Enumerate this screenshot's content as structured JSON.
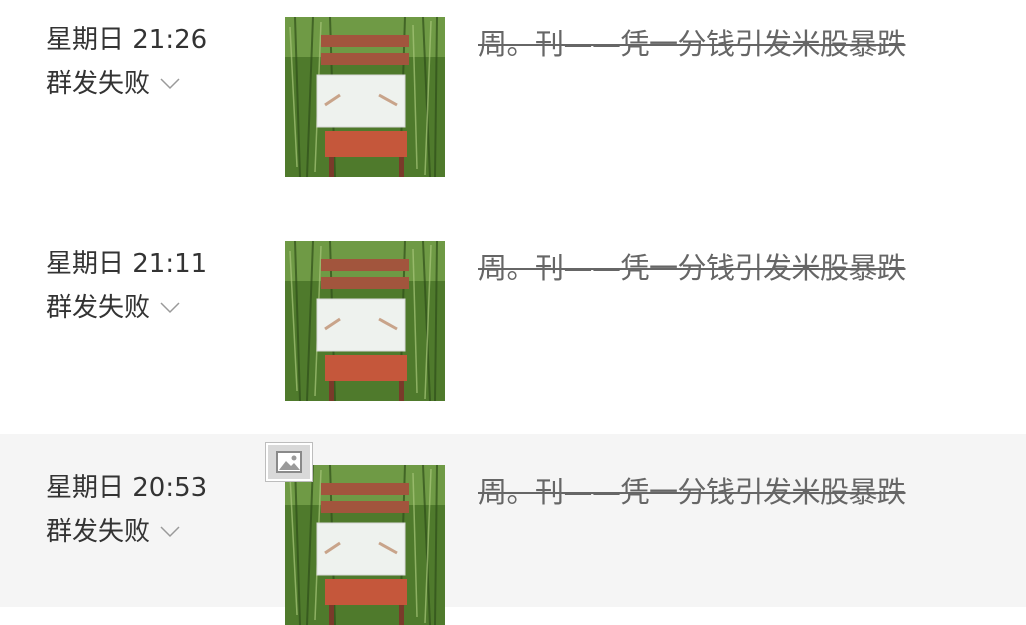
{
  "messages": [
    {
      "time": "星期日 21:26",
      "status": "群发失败",
      "title": "周。刊——凭一分钱引发米股暴跌"
    },
    {
      "time": "星期日 21:11",
      "status": "群发失败",
      "title": "周。刊——凭一分钱引发米股暴跌"
    },
    {
      "time": "星期日 20:53",
      "status": "群发失败",
      "title": "周。刊——凭一分钱引发米股暴跌"
    }
  ],
  "colors": {
    "selected_row_bg": "#f5f5f5",
    "text": "#333333",
    "title_text": "#666666",
    "chevron": "#9a9a9a"
  },
  "icons": {
    "status_dropdown": "chevron-down-icon",
    "thumbnail": "article-cover-image",
    "image_badge": "image-icon"
  }
}
